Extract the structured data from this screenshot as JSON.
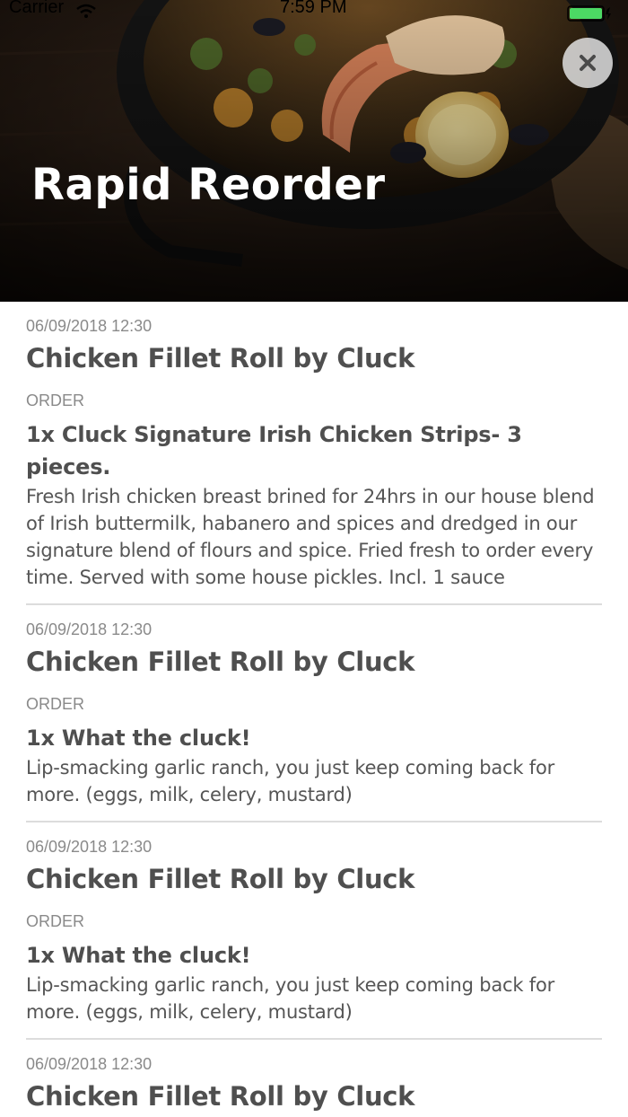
{
  "status_bar": {
    "carrier": "Carrier",
    "time": "7:59 PM",
    "wifi_icon": "wifi-icon",
    "battery_icon": "battery-icon",
    "battery_color": "#4cd964"
  },
  "header": {
    "title": "Rapid Reorder",
    "close_icon": "close-icon"
  },
  "orders": [
    {
      "date": "06/09/2018 12:30",
      "restaurant": "Chicken Fillet Roll by Cluck",
      "label": "ORDER",
      "item": "1x Cluck Signature Irish Chicken Strips- 3 pieces.",
      "description": "Fresh Irish chicken breast brined for 24hrs in our house blend of Irish buttermilk, habanero and spices and dredged in our signature blend of flours and spice. Fried fresh to order every time. Served with some house pickles. Incl. 1 sauce"
    },
    {
      "date": "06/09/2018 12:30",
      "restaurant": "Chicken Fillet Roll by Cluck",
      "label": "ORDER",
      "item": "1x What the cluck!",
      "description": "Lip-smacking garlic ranch, you just keep coming back for more. (eggs, milk, celery, mustard)"
    },
    {
      "date": "06/09/2018 12:30",
      "restaurant": "Chicken Fillet Roll by Cluck",
      "label": "ORDER",
      "item": "1x What the cluck!",
      "description": "Lip-smacking garlic ranch, you just keep coming back for more. (eggs, milk, celery, mustard)"
    },
    {
      "date": "06/09/2018 12:30",
      "restaurant": "Chicken Fillet Roll by Cluck"
    }
  ]
}
